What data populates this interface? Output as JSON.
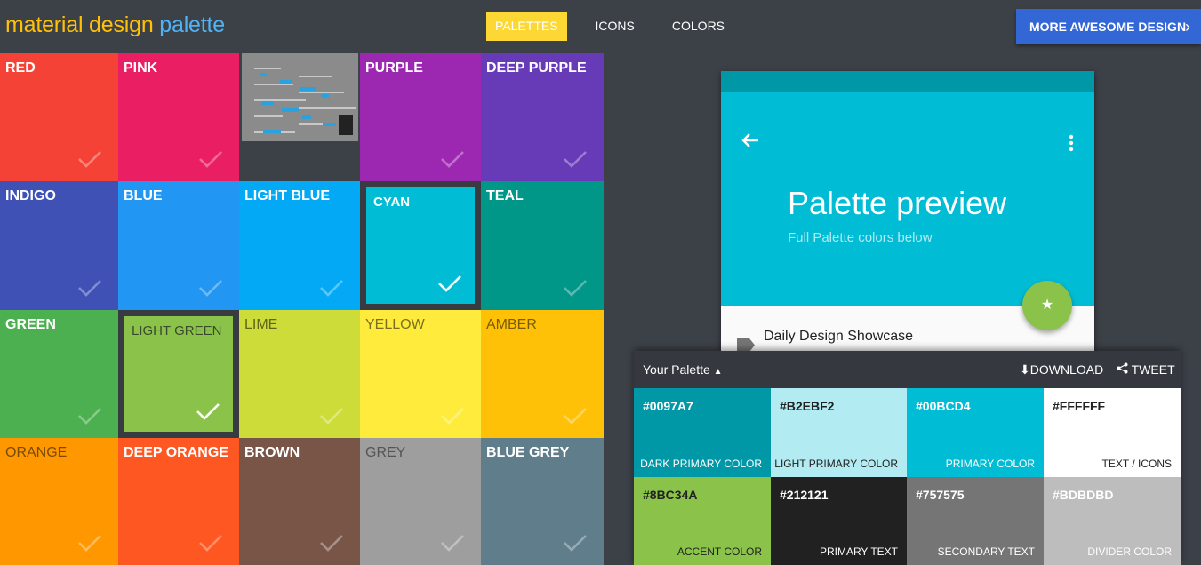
{
  "header": {
    "brand_part1": "material design",
    "brand_part2": "palette",
    "nav": [
      "PALETTES",
      "ICONS",
      "COLORS"
    ],
    "active_nav": "PALETTES",
    "cta_label": "MORE AWESOME DESIGN",
    "cta_icon": "chevron-right-icon"
  },
  "palette_grid": [
    {
      "label": "RED",
      "color": "#f44336",
      "text_color": "#ffffff",
      "checked": false,
      "selected": false
    },
    {
      "label": "PINK",
      "color": "#e91e63",
      "text_color": "#ffffff",
      "checked": false,
      "selected": false
    },
    {
      "label": "",
      "color": "#3c4148",
      "text_color": "#ffffff",
      "checked": false,
      "selected": false,
      "is_thumbnail": true
    },
    {
      "label": "PURPLE",
      "color": "#9c27b0",
      "text_color": "#ffffff",
      "checked": false,
      "selected": false
    },
    {
      "label": "DEEP PURPLE",
      "color": "#673ab7",
      "text_color": "#ffffff",
      "checked": false,
      "selected": false
    },
    {
      "label": "INDIGO",
      "color": "#3f51b5",
      "text_color": "#ffffff",
      "checked": false,
      "selected": false
    },
    {
      "label": "BLUE",
      "color": "#2196f3",
      "text_color": "#ffffff",
      "checked": false,
      "selected": false
    },
    {
      "label": "LIGHT BLUE",
      "color": "#03a9f4",
      "text_color": "#ffffff",
      "checked": false,
      "selected": false
    },
    {
      "label": "CYAN",
      "color": "#00bcd4",
      "text_color": "#ffffff",
      "checked": true,
      "selected": true
    },
    {
      "label": "TEAL",
      "color": "#009688",
      "text_color": "#ffffff",
      "checked": false,
      "selected": false
    },
    {
      "label": "GREEN",
      "color": "#4caf50",
      "text_color": "#ffffff",
      "checked": false,
      "selected": false
    },
    {
      "label": "LIGHT GREEN",
      "color": "#8bc34a",
      "text_color": "#3a4a2a",
      "checked": true,
      "selected": true
    },
    {
      "label": "LIME",
      "color": "#cddc39",
      "text_color": "#5f6619",
      "checked": false,
      "selected": false
    },
    {
      "label": "YELLOW",
      "color": "#ffeb3b",
      "text_color": "#7a7020",
      "checked": false,
      "selected": false
    },
    {
      "label": "AMBER",
      "color": "#ffc107",
      "text_color": "#7a5c05",
      "checked": false,
      "selected": false
    },
    {
      "label": "ORANGE",
      "color": "#ff9800",
      "text_color": "#7a4a05",
      "checked": false,
      "selected": false
    },
    {
      "label": "DEEP ORANGE",
      "color": "#ff5722",
      "text_color": "#ffffff",
      "checked": false,
      "selected": false
    },
    {
      "label": "BROWN",
      "color": "#795548",
      "text_color": "#ffffff",
      "checked": false,
      "selected": false
    },
    {
      "label": "GREY",
      "color": "#9e9e9e",
      "text_color": "#555555",
      "checked": false,
      "selected": false
    },
    {
      "label": "BLUE GREY",
      "color": "#607d8b",
      "text_color": "#ffffff",
      "checked": false,
      "selected": false
    }
  ],
  "preview": {
    "title": "Palette preview",
    "subtitle": "Full Palette colors below",
    "list_item": "Daily Design Showcase",
    "fab_icon": "star-icon",
    "back_icon": "arrow-back-icon",
    "more_icon": "more-vert-icon"
  },
  "your_palette": {
    "title": "Your Palette",
    "download_label": "DOWNLOAD",
    "tweet_label": "TWEET",
    "swatches": [
      {
        "hex": "#0097A7",
        "role": "DARK PRIMARY COLOR",
        "color": "#0097a7",
        "text_color": "#ffffff"
      },
      {
        "hex": "#B2EBF2",
        "role": "LIGHT PRIMARY COLOR",
        "color": "#b2ebf2",
        "text_color": "#212121"
      },
      {
        "hex": "#00BCD4",
        "role": "PRIMARY COLOR",
        "color": "#00bcd4",
        "text_color": "#ffffff"
      },
      {
        "hex": "#FFFFFF",
        "role": "TEXT / ICONS",
        "color": "#ffffff",
        "text_color": "#212121"
      },
      {
        "hex": "#8BC34A",
        "role": "ACCENT COLOR",
        "color": "#8bc34a",
        "text_color": "#212121"
      },
      {
        "hex": "#212121",
        "role": "PRIMARY TEXT",
        "color": "#212121",
        "text_color": "#ffffff"
      },
      {
        "hex": "#757575",
        "role": "SECONDARY TEXT",
        "color": "#757575",
        "text_color": "#ffffff"
      },
      {
        "hex": "#BDBDBD",
        "role": "DIVIDER COLOR",
        "color": "#bdbdbd",
        "text_color": "#ffffff"
      }
    ]
  }
}
